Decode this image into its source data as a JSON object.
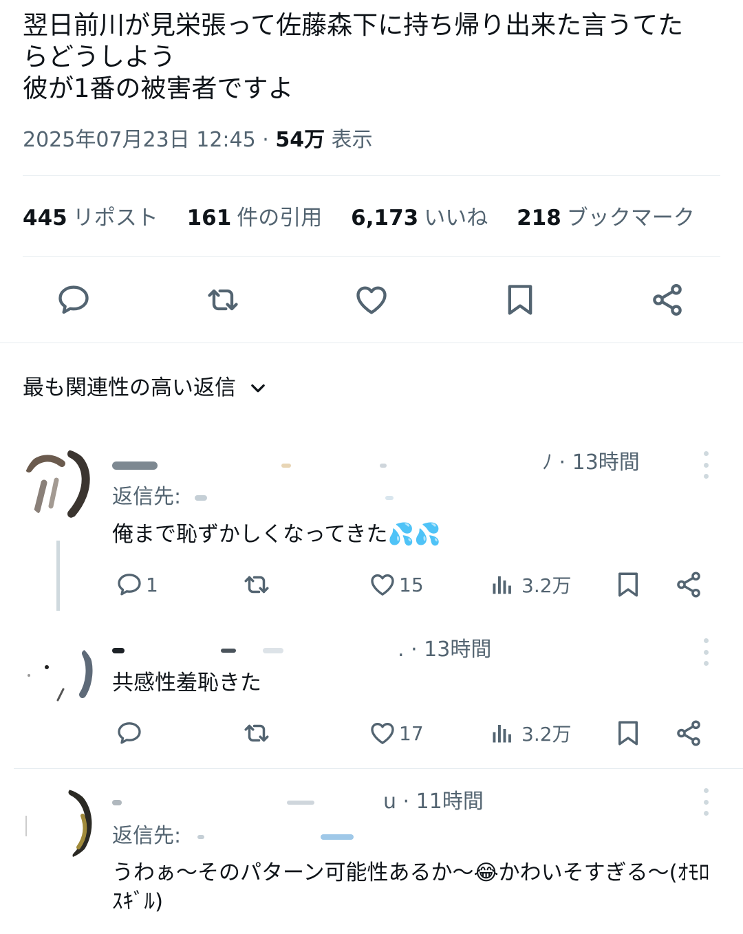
{
  "tweet": {
    "lines": [
      "翌日前川が見栄張って佐藤森下に持ち帰り出来た言うてた",
      "らどうしよう",
      "彼が1番の被害者ですよ"
    ],
    "timestamp": "2025年07月23日 12:45",
    "separator": "·",
    "views_count": "54万",
    "views_label": "表示"
  },
  "stats": [
    {
      "num": "445",
      "label": "リポスト"
    },
    {
      "num": "161",
      "label": "件の引用"
    },
    {
      "num": "6,173",
      "label": "いいね"
    },
    {
      "num": "218",
      "label": "ブックマーク"
    }
  ],
  "actions": {
    "icons": [
      "reply-icon",
      "retweet-icon",
      "like-icon",
      "bookmark-icon",
      "share-icon"
    ]
  },
  "sort": {
    "label": "最も関連性の高い返信"
  },
  "replies": [
    {
      "time": "13時間",
      "time_prefix": "ﾉ ·",
      "reply_to_label": "返信先:",
      "text": "俺まで恥ずかしくなってきた💦💦",
      "reply_count": "1",
      "retweet_count": "",
      "like_count": "15",
      "view_count": "3.2万"
    },
    {
      "time": "13時間",
      "time_prefix": ". ·",
      "text": "共感性羞恥きた",
      "reply_count": "",
      "retweet_count": "",
      "like_count": "17",
      "view_count": "3.2万"
    },
    {
      "time": "11時間",
      "time_prefix": "u ·",
      "reply_to_label": "返信先:",
      "text_line1": "うわぁ～そのパターン可能性あるか～😂かわいそすぎる～(ｵﾓﾛ",
      "text_line2": "ｽｷﾞﾙ)"
    }
  ],
  "colors": {
    "text": "#0f1419",
    "secondary": "#536471",
    "divider": "#e6ecf0",
    "icon": "#536471"
  }
}
